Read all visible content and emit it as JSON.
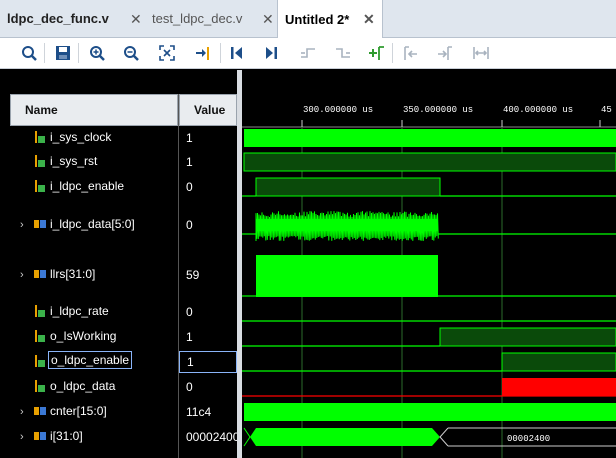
{
  "tabs": [
    {
      "label": "ldpc_dec_func.v",
      "active": false
    },
    {
      "label": "test_ldpc_dec.v",
      "active": false
    },
    {
      "label": "Untitled 2*",
      "active": true
    }
  ],
  "toolbar": {
    "icons": [
      "search-icon",
      "save-icon",
      "zoom-in-icon",
      "zoom-out-icon",
      "zoom-fit-icon",
      "goto-cursor-icon",
      "goto-time-zero-icon",
      "goto-last-time-icon",
      "previous-transition-icon",
      "next-transition-icon",
      "add-marker-icon",
      "previous-marker-icon",
      "next-marker-icon",
      "swap-cursors-icon"
    ]
  },
  "columns": {
    "name": "Name",
    "value": "Value"
  },
  "time_axis": {
    "ticks": [
      "300.000000 us",
      "350.000000 us",
      "400.000000 us",
      "45"
    ]
  },
  "signals": [
    {
      "name": "i_sys_clock",
      "value": "1",
      "kind": "bit",
      "expandable": false
    },
    {
      "name": "i_sys_rst",
      "value": "1",
      "kind": "bit",
      "expandable": false
    },
    {
      "name": "i_ldpc_enable",
      "value": "0",
      "kind": "bit",
      "expandable": false
    },
    {
      "name": "i_ldpc_data[5:0]",
      "value": "0",
      "kind": "bus",
      "expandable": true
    },
    {
      "name": "llrs[31:0]",
      "value": "59",
      "kind": "bus",
      "expandable": true
    },
    {
      "name": "i_ldpc_rate",
      "value": "0",
      "kind": "bit",
      "expandable": false
    },
    {
      "name": "o_IsWorking",
      "value": "1",
      "kind": "bit",
      "expandable": false
    },
    {
      "name": "o_ldpc_enable",
      "value": "1",
      "kind": "bit",
      "expandable": false,
      "selected": true
    },
    {
      "name": "o_ldpc_data",
      "value": "0",
      "kind": "bit",
      "expandable": false
    },
    {
      "name": "cnter[15:0]",
      "value": "11c4",
      "kind": "bus",
      "expandable": true
    },
    {
      "name": "i[31:0]",
      "value": "00002400",
      "kind": "bus",
      "expandable": true
    }
  ],
  "bus_labels": {
    "i_value": "00002400"
  },
  "colors": {
    "wave_green": "#00ff00",
    "wave_dark": "#0a4a0a",
    "error_red": "#ff0000",
    "selected_border": "#8ab4f8"
  }
}
